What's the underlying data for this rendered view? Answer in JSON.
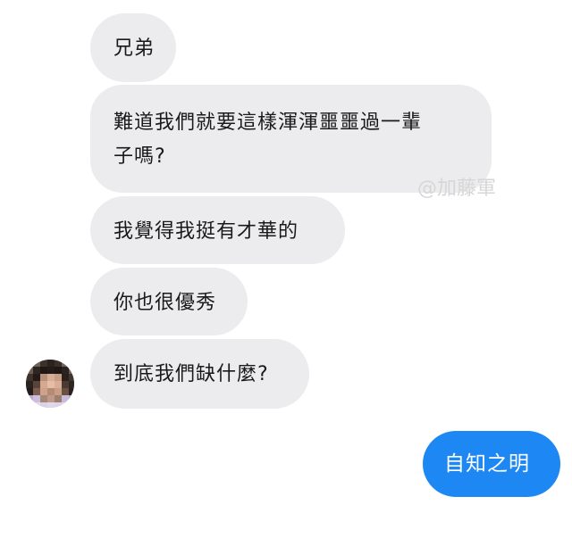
{
  "messages": {
    "received": [
      {
        "text": "兄弟"
      },
      {
        "lines": [
          "難道我們就要這樣渾渾噩噩過一輩",
          "子嗎?"
        ]
      },
      {
        "text": "我覺得我挺有才華的"
      },
      {
        "text": "你也很優秀"
      },
      {
        "text": "到底我們缺什麼?"
      }
    ],
    "sent": [
      {
        "text": "自知之明"
      }
    ]
  },
  "watermark": "@加藤軍",
  "colors": {
    "received_bubble": "#ececef",
    "sent_bubble": "#1d88f3",
    "received_text": "#1a1a1a",
    "sent_text": "#ffffff",
    "watermark": "#d6d6d6"
  },
  "icons": {
    "avatar": "pixelated-avatar"
  }
}
